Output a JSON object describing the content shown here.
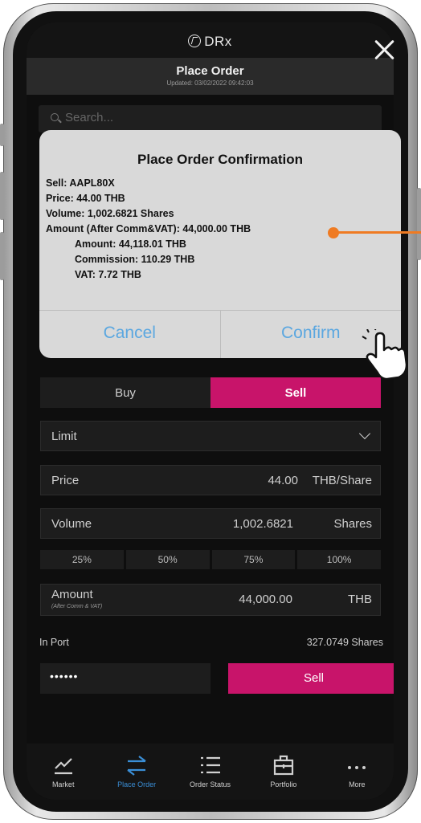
{
  "app": {
    "brand": "DRx"
  },
  "header": {
    "title": "Place Order",
    "updated": "Updated: 03/02/2022 09:42:03"
  },
  "search": {
    "placeholder": "Search..."
  },
  "modal": {
    "title": "Place Order Confirmation",
    "lines": [
      "Sell: AAPL80X",
      "Price: 44.00 THB",
      "Volume: 1,002.6821 Shares",
      "Amount (After Comm&VAT): 44,000.00 THB"
    ],
    "indented_lines": [
      "Amount: 44,118.01 THB",
      "Commission: 110.29 THB",
      "VAT: 7.72 THB"
    ],
    "cancel_label": "Cancel",
    "confirm_label": "Confirm"
  },
  "order": {
    "buy_label": "Buy",
    "sell_label": "Sell",
    "type": "Limit",
    "price_label": "Price",
    "price_value": "44.00",
    "price_unit": "THB/Share",
    "volume_label": "Volume",
    "volume_value": "1,002.6821",
    "volume_unit": "Shares",
    "percent_buttons": [
      "25%",
      "50%",
      "75%",
      "100%"
    ],
    "amount_label": "Amount",
    "amount_sublabel": "(After Comm & VAT)",
    "amount_value": "44,000.00",
    "amount_unit": "THB",
    "in_port_label": "In Port",
    "in_port_value": "327.0749 Shares",
    "pin_value": "••••••",
    "submit_label": "Sell"
  },
  "tabs": [
    {
      "label": "Market",
      "icon": "chart-line-icon"
    },
    {
      "label": "Place Order",
      "icon": "swap-arrows-icon"
    },
    {
      "label": "Order Status",
      "icon": "list-icon"
    },
    {
      "label": "Portfolio",
      "icon": "briefcase-icon"
    },
    {
      "label": "More",
      "icon": "more-dots-icon"
    }
  ],
  "colors": {
    "accent": "#c8146a",
    "link": "#5ba7e0",
    "active_tab": "#3a8ed6",
    "pointer": "#ef7b23"
  }
}
